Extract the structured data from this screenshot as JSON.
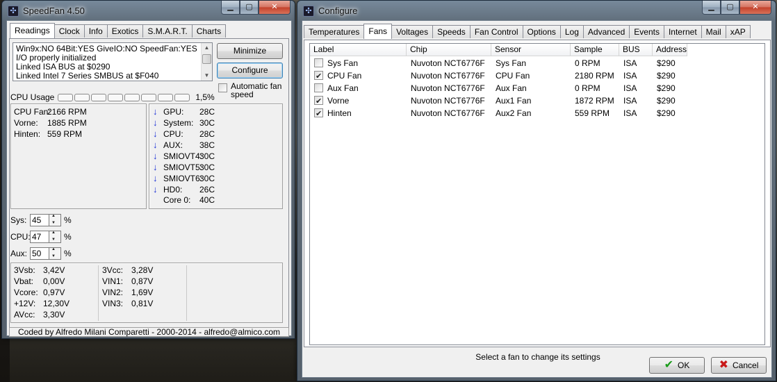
{
  "speedfan": {
    "title": "SpeedFan 4.50",
    "tabs": [
      "Readings",
      "Clock",
      "Info",
      "Exotics",
      "S.M.A.R.T.",
      "Charts"
    ],
    "log_lines": [
      "Win9x:NO  64Bit:YES  GiveIO:NO  SpeedFan:YES",
      "I/O properly initialized",
      "Linked ISA BUS at $0290",
      "Linked Intel 7 Series SMBUS at $F040"
    ],
    "minimize_label": "Minimize",
    "configure_label": "Configure",
    "auto_fan_label": "Automatic fan speed",
    "auto_fan_checked": false,
    "cpu_usage_label": "CPU Usage",
    "cpu_usage_value": "1,5%",
    "fans": [
      {
        "name": "CPU Fan:",
        "value": "2166 RPM"
      },
      {
        "name": "Vorne:",
        "value": "1885 RPM"
      },
      {
        "name": "Hinten:",
        "value": "559 RPM"
      }
    ],
    "temps": [
      {
        "name": "GPU:",
        "value": "28C",
        "trend": "down"
      },
      {
        "name": "System:",
        "value": "30C",
        "trend": "down"
      },
      {
        "name": "CPU:",
        "value": "28C",
        "trend": "down"
      },
      {
        "name": "AUX:",
        "value": "38C",
        "trend": "down"
      },
      {
        "name": "SMIOVT4:",
        "value": "30C",
        "trend": "down"
      },
      {
        "name": "SMIOVT5:",
        "value": "30C",
        "trend": "down"
      },
      {
        "name": "SMIOVT6:",
        "value": "30C",
        "trend": "down"
      },
      {
        "name": "HD0:",
        "value": "26C",
        "trend": "down"
      },
      {
        "name": "Core 0:",
        "value": "40C",
        "trend": "none"
      }
    ],
    "speeds": [
      {
        "label": "Sys:",
        "value": "45",
        "unit": "%"
      },
      {
        "label": "CPU:",
        "value": "47",
        "unit": "%"
      },
      {
        "label": "Aux:",
        "value": "50",
        "unit": "%"
      }
    ],
    "volts_left": [
      {
        "name": "3Vsb:",
        "value": "3,42V"
      },
      {
        "name": "Vbat:",
        "value": "0,00V"
      },
      {
        "name": "Vcore:",
        "value": "0,97V"
      },
      {
        "name": "+12V:",
        "value": "12,30V"
      },
      {
        "name": "AVcc:",
        "value": "3,30V"
      }
    ],
    "volts_right": [
      {
        "name": "3Vcc:",
        "value": "3,28V"
      },
      {
        "name": "VIN1:",
        "value": "0,87V"
      },
      {
        "name": "VIN2:",
        "value": "1,69V"
      },
      {
        "name": "VIN3:",
        "value": "0,81V"
      }
    ],
    "credits": "Coded by Alfredo Milani Comparetti - 2000-2014 - alfredo@almico.com"
  },
  "configure": {
    "title": "Configure",
    "tabs": [
      "Temperatures",
      "Fans",
      "Voltages",
      "Speeds",
      "Fan Control",
      "Options",
      "Log",
      "Advanced",
      "Events",
      "Internet",
      "Mail",
      "xAP"
    ],
    "active_tab": "Fans",
    "columns": [
      "Label",
      "Chip",
      "Sensor",
      "Sample",
      "BUS",
      "Address"
    ],
    "rows": [
      {
        "checked": false,
        "label": "Sys Fan",
        "chip": "Nuvoton NCT6776F",
        "sensor": "Sys Fan",
        "sample": "0 RPM",
        "bus": "ISA",
        "address": "$290"
      },
      {
        "checked": true,
        "label": "CPU Fan",
        "chip": "Nuvoton NCT6776F",
        "sensor": "CPU Fan",
        "sample": "2180 RPM",
        "bus": "ISA",
        "address": "$290"
      },
      {
        "checked": false,
        "label": "Aux Fan",
        "chip": "Nuvoton NCT6776F",
        "sensor": "Aux Fan",
        "sample": "0 RPM",
        "bus": "ISA",
        "address": "$290"
      },
      {
        "checked": true,
        "label": "Vorne",
        "chip": "Nuvoton NCT6776F",
        "sensor": "Aux1 Fan",
        "sample": "1872 RPM",
        "bus": "ISA",
        "address": "$290"
      },
      {
        "checked": true,
        "label": "Hinten",
        "chip": "Nuvoton NCT6776F",
        "sensor": "Aux2 Fan",
        "sample": "559 RPM",
        "bus": "ISA",
        "address": "$290"
      }
    ],
    "hint": "Select a fan to change its settings",
    "ok_label": "OK",
    "cancel_label": "Cancel"
  },
  "colors": {
    "trend_arrow": "#1a2fd6",
    "ok_icon": "#1a9c1a",
    "cancel_icon": "#c81818"
  }
}
